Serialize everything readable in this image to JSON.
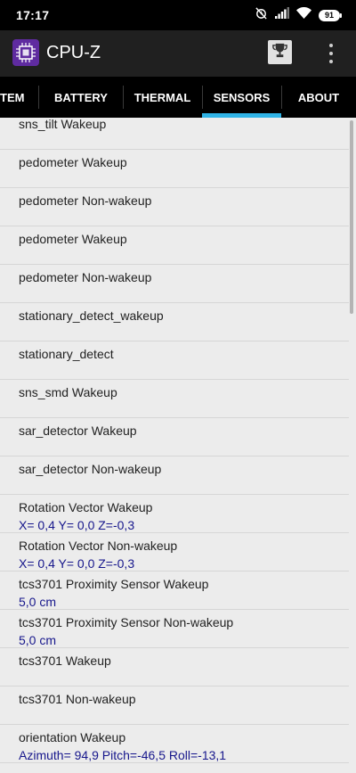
{
  "status_bar": {
    "time": "17:17",
    "battery_level": "91"
  },
  "app_bar": {
    "title": "CPU-Z"
  },
  "tabs": [
    {
      "label": "TEM",
      "active": false
    },
    {
      "label": "BATTERY",
      "active": false
    },
    {
      "label": "THERMAL",
      "active": false
    },
    {
      "label": "SENSORS",
      "active": true
    },
    {
      "label": "ABOUT",
      "active": false
    }
  ],
  "sensors": [
    {
      "name": "sns_tilt  Wakeup",
      "value": ""
    },
    {
      "name": "pedometer  Wakeup",
      "value": ""
    },
    {
      "name": "pedometer  Non-wakeup",
      "value": ""
    },
    {
      "name": "pedometer  Wakeup",
      "value": ""
    },
    {
      "name": "pedometer  Non-wakeup",
      "value": ""
    },
    {
      "name": "stationary_detect_wakeup",
      "value": ""
    },
    {
      "name": "stationary_detect",
      "value": ""
    },
    {
      "name": "sns_smd  Wakeup",
      "value": ""
    },
    {
      "name": "sar_detector  Wakeup",
      "value": ""
    },
    {
      "name": "sar_detector  Non-wakeup",
      "value": ""
    },
    {
      "name": "Rotation Vector  Wakeup",
      "value": "X= 0,4   Y= 0,0   Z=-0,3"
    },
    {
      "name": "Rotation Vector  Non-wakeup",
      "value": "X= 0,4   Y= 0,0   Z=-0,3"
    },
    {
      "name": "tcs3701 Proximity Sensor Wakeup",
      "value": "5,0 cm"
    },
    {
      "name": "tcs3701 Proximity Sensor Non-wakeup",
      "value": "5,0 cm"
    },
    {
      "name": "tcs3701  Wakeup",
      "value": ""
    },
    {
      "name": "tcs3701  Non-wakeup",
      "value": ""
    },
    {
      "name": "orientation  Wakeup",
      "value": "Azimuth= 94,9    Pitch=-46,5    Roll=-13,1"
    }
  ],
  "colors": {
    "accent": "#2fb3e6",
    "value_text": "#17178c",
    "app_bar": "#202020",
    "list_background": "#ececec"
  }
}
